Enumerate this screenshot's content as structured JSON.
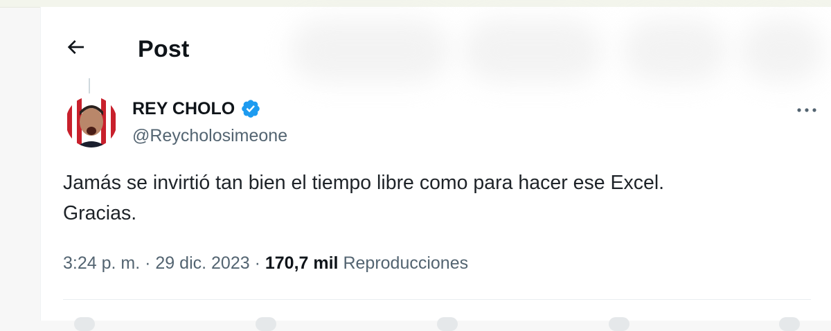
{
  "header": {
    "title": "Post"
  },
  "tweet": {
    "display_name": "REY CHOLO",
    "handle": "@Reycholosimeone",
    "text_line1": "Jamás se invirtió tan bien el tiempo libre como para hacer ese Excel.",
    "text_line2": "Gracias.",
    "time": "3:24 p. m.",
    "separator": "·",
    "date": "29 dic. 2023",
    "views_count": "170,7 mil",
    "views_label": "Reproducciones"
  },
  "icons": {
    "back": "arrow-left-icon",
    "verified": "verified-badge-icon",
    "more": "more-horizontal-icon"
  },
  "colors": {
    "verified_blue": "#1d9bf0",
    "secondary_text": "#536471",
    "primary_text": "#0f1419"
  }
}
